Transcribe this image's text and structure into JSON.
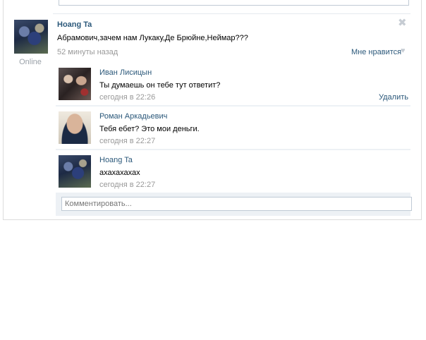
{
  "post": {
    "author": "Hoang Ta",
    "status": "Online",
    "text": "Абрамович,зачем нам Лукаку,Де Брюйне,Неймар???",
    "time": "52 минуты назад",
    "like_label": "Мне нравится",
    "close_symbol": "✖",
    "heart_symbol": "♥"
  },
  "replies": [
    {
      "author": "Иван Лисицын",
      "text": "Ты думаешь он тебе тут ответит?",
      "time": "сегодня в 22:26",
      "delete_label": "Удалить"
    },
    {
      "author": "Роман Аркадьевич",
      "text": "Тебя ебет? Это мои деньги.",
      "time": "сегодня в 22:27"
    },
    {
      "author": "Hoang Ta",
      "text": "ахахахахах",
      "time": "сегодня в 22:27"
    }
  ],
  "comment": {
    "placeholder": "Комментировать..."
  },
  "colors": {
    "link": "#2b587a",
    "muted": "#999999",
    "reply_bg": "#edf1f5"
  }
}
